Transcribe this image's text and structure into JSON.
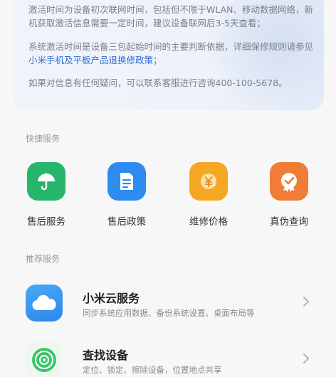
{
  "info": {
    "p1": "激活时间为设备初次联网时间，包括但不限于WLAN、移动数据网络，新机获取激活信息需要一定时间，建议设备联网后3-5天查看；",
    "p2_pre": "系统激活时间是设备三包起始时间的主要判断依据，详细保修规则请参见",
    "p2_link": "小米手机及平板产品退换修政策",
    "p2_post": "；",
    "p3": "如果对信息有任何疑问，可以联系客服进行咨询400-100-5678。"
  },
  "quick_services": {
    "title": "快捷服务",
    "items": [
      {
        "label": "售后服务",
        "icon": "umbrella-icon",
        "color": "#25b66c"
      },
      {
        "label": "售后政策",
        "icon": "document-icon",
        "color": "#2e8cf0"
      },
      {
        "label": "维修价格",
        "icon": "yuan-coin-icon",
        "color": "#f5a623"
      },
      {
        "label": "真伪查询",
        "icon": "verified-check-icon",
        "color": "#f07c35"
      }
    ]
  },
  "recommended": {
    "title": "推荐服务",
    "items": [
      {
        "title": "小米云服务",
        "subtitle": "同步系统应用数据、备份系统设置、桌面布局等",
        "icon": "cloud-icon"
      },
      {
        "title": "查找设备",
        "subtitle": "定位、锁定、擦除设备，位置地点共享",
        "icon": "radar-icon"
      }
    ]
  }
}
